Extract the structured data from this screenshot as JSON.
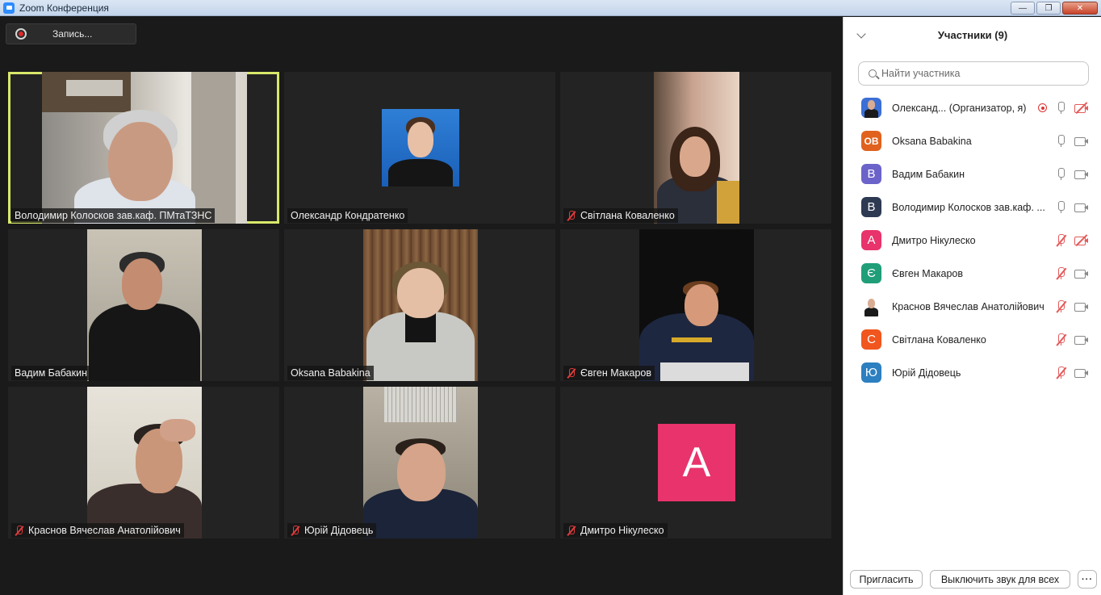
{
  "window": {
    "title": "Zoom Конференция"
  },
  "recording": {
    "label": "Запись..."
  },
  "gallery": [
    {
      "name": "Володимир Колосков зав.каф. ПМтаТЗНС",
      "muted": false,
      "active": true
    },
    {
      "name": "Олександр Кондратенко",
      "muted": false,
      "active": false
    },
    {
      "name": "Світлана Коваленко",
      "muted": true,
      "active": false
    },
    {
      "name": "Вадим Бабакин",
      "muted": false,
      "active": false
    },
    {
      "name": "Oksana Babakina",
      "muted": false,
      "active": false
    },
    {
      "name": "Євген Макаров",
      "muted": true,
      "active": false
    },
    {
      "name": "Краснов Вячеслав Анатолійович",
      "muted": true,
      "active": false
    },
    {
      "name": "Юрій Дідовець",
      "muted": true,
      "active": false
    },
    {
      "name": "Дмитро Нікулеско",
      "muted": true,
      "active": false,
      "avatar_letter": "A",
      "avatar_color": "#e8336c"
    }
  ],
  "sidebar": {
    "title": "Участники (9)",
    "search_placeholder": "Найти участника",
    "participants": [
      {
        "name": "Олександ...  (Организатор, я)",
        "avatar": "photo",
        "color": "#3b6fd6",
        "recording": true,
        "mic_muted": false,
        "cam_off": true
      },
      {
        "name": "Oksana Babakina",
        "avatar": "OB",
        "color": "#e0621e",
        "recording": false,
        "mic_muted": false,
        "cam_off": false
      },
      {
        "name": "Вадим Бабакин",
        "avatar": "В",
        "color": "#6b63c9",
        "recording": false,
        "mic_muted": false,
        "cam_off": false
      },
      {
        "name": "Володимир Колосков зав.каф. ...",
        "avatar": "В",
        "color": "#2d3a52",
        "recording": false,
        "mic_muted": false,
        "cam_off": false
      },
      {
        "name": "Дмитро Нікулеско",
        "avatar": "А",
        "color": "#e8336c",
        "recording": false,
        "mic_muted": true,
        "cam_off": true
      },
      {
        "name": "Євген Макаров",
        "avatar": "Є",
        "color": "#1f9e78",
        "recording": false,
        "mic_muted": true,
        "cam_off": false
      },
      {
        "name": "Краснов Вячеслав Анатолійович",
        "avatar": "photo",
        "color": "#ffffff",
        "recording": false,
        "mic_muted": true,
        "cam_off": false
      },
      {
        "name": "Світлана Коваленко",
        "avatar": "С",
        "color": "#f0561e",
        "recording": false,
        "mic_muted": true,
        "cam_off": false
      },
      {
        "name": "Юрій Дідовець",
        "avatar": "Ю",
        "color": "#2c7fc0",
        "recording": false,
        "mic_muted": true,
        "cam_off": false
      }
    ],
    "footer": {
      "invite_label": "Пригласить",
      "mute_all_label": "Выключить звук для всех",
      "more_label": "···"
    }
  }
}
